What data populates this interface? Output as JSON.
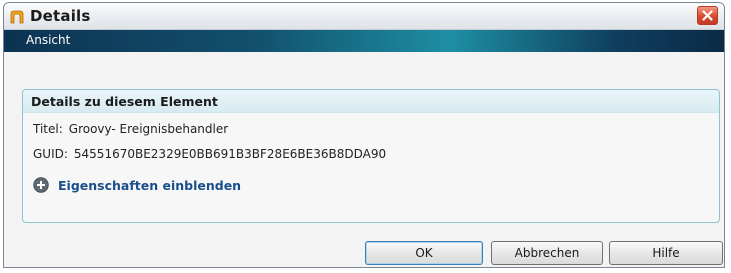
{
  "window": {
    "title": "Details",
    "icon": "folder-icon",
    "close_icon": "close-icon"
  },
  "menu": {
    "items": [
      {
        "label": "Ansicht"
      }
    ]
  },
  "details": {
    "header": "Details zu diesem Element",
    "titel_label": "Titel:",
    "titel_value": "Groovy- Ereignisbehandler",
    "guid_label": "GUID:",
    "guid_value": "54551670BE2329E0BB691B3BF28E6BE36B8DDA90",
    "expand_label": "Eigenschaften einblenden",
    "expand_icon": "plus-circle-icon"
  },
  "buttons": {
    "ok": "OK",
    "cancel": "Abbrechen",
    "help": "Hilfe"
  },
  "colors": {
    "menubar_accent": "#1e8ea3",
    "link": "#1a4f8c",
    "close": "#d84b2e"
  }
}
